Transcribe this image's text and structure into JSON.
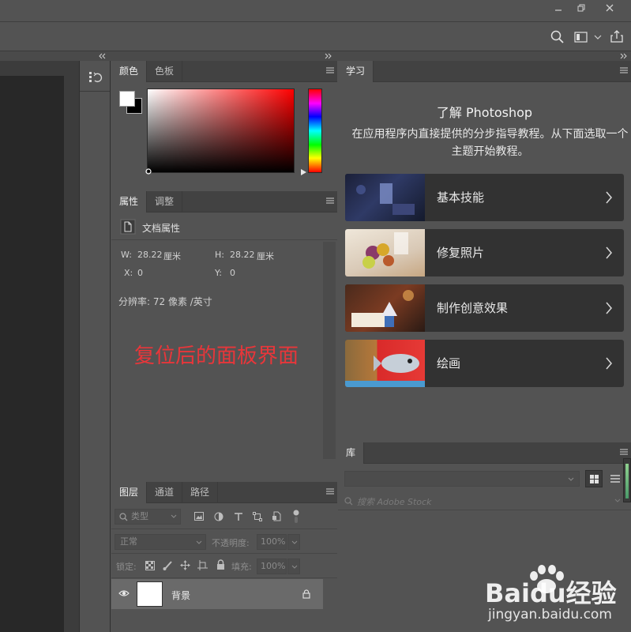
{
  "options_bar": {
    "icons": [
      "search-icon",
      "workspace-icon",
      "chevron-down-icon",
      "share-icon"
    ]
  },
  "color_panel": {
    "tabs": [
      "颜色",
      "色板"
    ]
  },
  "properties_panel": {
    "tabs": [
      "属性",
      "调整"
    ],
    "section_label": "文档属性",
    "w_label": "W:",
    "w_value": "28.22",
    "w_unit": "厘米",
    "h_label": "H:",
    "h_value": "28.22",
    "h_unit": "厘米",
    "x_label": "X:",
    "x_value": "0",
    "y_label": "Y:",
    "y_value": "0",
    "resolution": "分辨率: 72 像素 /英寸"
  },
  "annotation": {
    "text": "复位后的面板界面",
    "color": "#e8363a"
  },
  "layers_panel": {
    "tabs": [
      "图层",
      "通道",
      "路径"
    ],
    "filter_kind": "类型",
    "blend_mode": "正常",
    "opacity_label": "不透明度:",
    "opacity_value": "100%",
    "lock_label": "锁定:",
    "fill_label": "填充:",
    "fill_value": "100%",
    "layers": [
      {
        "name": "背景"
      }
    ]
  },
  "learn_panel": {
    "tab": "学习",
    "title": "了解 Photoshop",
    "description": "在应用程序内直接提供的分步指导教程。从下面选取一个主题开始教程。",
    "cards": [
      {
        "label": "基本技能"
      },
      {
        "label": "修复照片"
      },
      {
        "label": "制作创意效果"
      },
      {
        "label": "绘画"
      }
    ]
  },
  "library_panel": {
    "tab": "库",
    "search_placeholder": "搜索 Adobe Stock"
  },
  "watermark": {
    "brand": "Baidu经验",
    "url": "jingyan.baidu.com"
  }
}
